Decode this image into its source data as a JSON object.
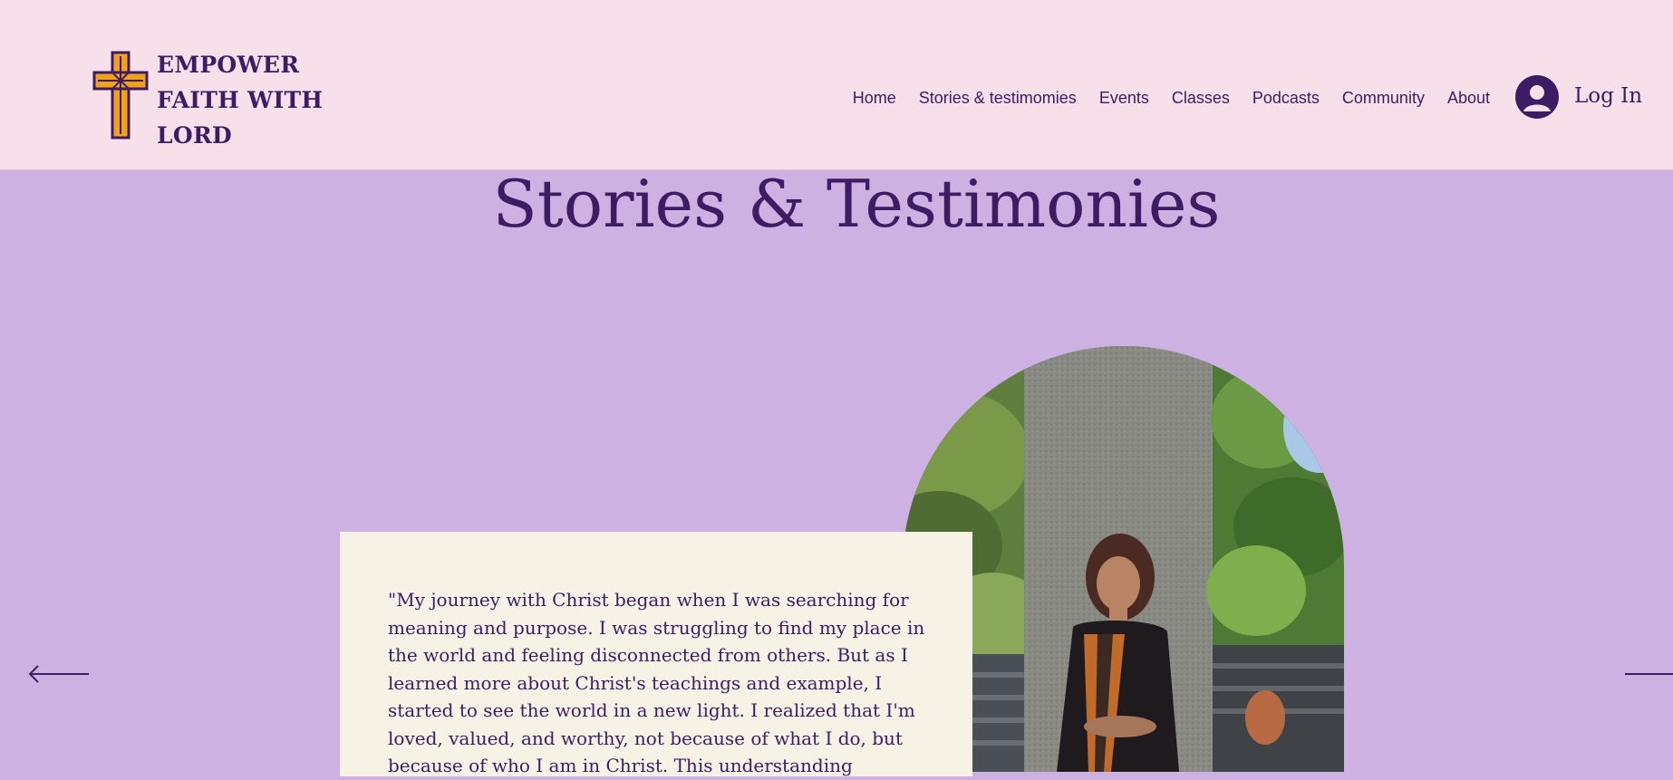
{
  "header": {
    "brand_lines": [
      "EMPOWER",
      "FAITH WITH",
      "LORD"
    ],
    "nav": [
      "Home",
      "Stories & testimomies",
      "Events",
      "Classes",
      "Podcasts",
      "Community",
      "About"
    ],
    "login_label": "Log In"
  },
  "main": {
    "title": "Stories & Testimonies",
    "quote": "\"My journey with Christ began when I was searching for meaning and purpose. I was struggling to find my place in the world and feeling disconnected from others. But as I learned more about Christ's teachings and example, I started to see the world in a new light. I realized that I'm loved, valued, and worthy, not because of what I do, but because of who I am in Christ. This understanding"
  },
  "icons": {
    "logo": "cross-logo-icon",
    "avatar": "user-avatar-icon",
    "prev": "arrow-left-icon",
    "next": "arrow-right-icon"
  },
  "colors": {
    "header_bg": "#f7e0ea",
    "page_bg": "#ccb1e2",
    "accent": "#3d1c63",
    "card_bg": "#f6f2e6",
    "cross_gold": "#f0a21e"
  }
}
